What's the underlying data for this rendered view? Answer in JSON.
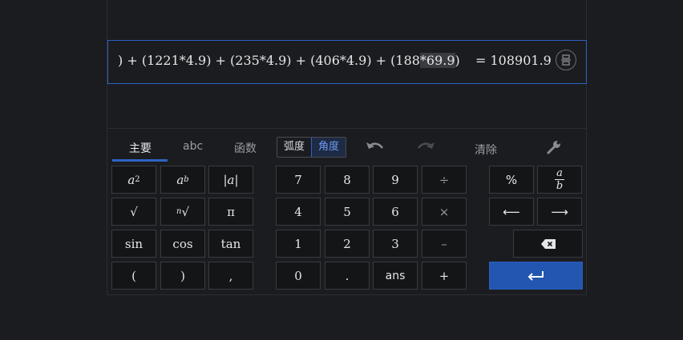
{
  "expression": {
    "prefix": ") + (1221*4.9) + (235*4.9) + (406*4.9) + (188",
    "highlight": "*69.9",
    "suffix": ")",
    "result": "= 108901.9"
  },
  "tabs": {
    "main": "主要",
    "abc": "abc",
    "functions": "函数"
  },
  "angle": {
    "radians": "弧度",
    "degrees": "角度"
  },
  "toolbar": {
    "clear": "清除"
  },
  "keys": {
    "a2_base": "a",
    "a2_exp": "2",
    "ab_base": "a",
    "ab_exp": "b",
    "abs": "|a|",
    "sqrt": "√",
    "nroot_n": "n",
    "nroot": "√",
    "pi": "π",
    "sin": "sin",
    "cos": "cos",
    "tan": "tan",
    "lparen": "(",
    "rparen": ")",
    "comma": ",",
    "seven": "7",
    "eight": "8",
    "nine": "9",
    "divide": "÷",
    "four": "4",
    "five": "5",
    "six": "6",
    "multiply": "×",
    "one": "1",
    "two": "2",
    "three": "3",
    "minus": "–",
    "zero": "0",
    "dot": ".",
    "ans": "ans",
    "plus": "+",
    "percent": "%",
    "frac_num": "a",
    "frac_den": "b",
    "left": "⟵",
    "right": "⟶"
  },
  "colors": {
    "accent": "#2256b0",
    "border_focus": "#2d62c6",
    "background": "#1b1c1f"
  }
}
